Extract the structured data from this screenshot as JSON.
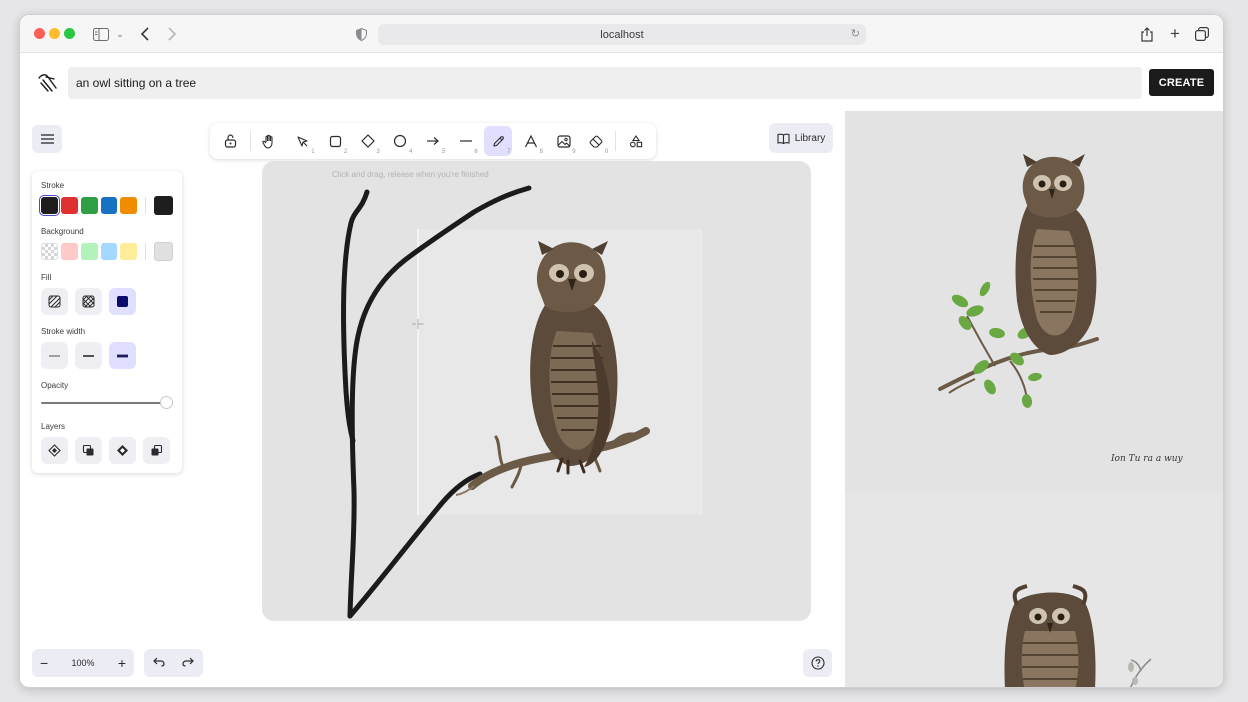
{
  "browser": {
    "url": "localhost"
  },
  "prompt": {
    "value": "an owl sitting on a tree",
    "create_label": "CREATE"
  },
  "toolbar": {
    "tools": [
      {
        "name": "lock-tool",
        "icon": "lock-icon",
        "key": ""
      },
      {
        "name": "hand-tool",
        "icon": "hand-icon",
        "key": ""
      },
      {
        "name": "selection-tool",
        "icon": "cursor-icon",
        "key": "1"
      },
      {
        "name": "rectangle-tool",
        "icon": "rectangle-icon",
        "key": "2"
      },
      {
        "name": "diamond-tool",
        "icon": "diamond-icon",
        "key": "3"
      },
      {
        "name": "ellipse-tool",
        "icon": "ellipse-icon",
        "key": "4"
      },
      {
        "name": "arrow-tool",
        "icon": "arrow-icon",
        "key": "5"
      },
      {
        "name": "line-tool",
        "icon": "line-icon",
        "key": "6"
      },
      {
        "name": "draw-tool",
        "icon": "pencil-icon",
        "key": "7",
        "active": true
      },
      {
        "name": "text-tool",
        "icon": "text-icon",
        "key": "8"
      },
      {
        "name": "image-tool",
        "icon": "image-icon",
        "key": "9"
      },
      {
        "name": "eraser-tool",
        "icon": "eraser-icon",
        "key": "0"
      },
      {
        "name": "shapes-tool",
        "icon": "shapes-icon",
        "key": ""
      }
    ],
    "library_label": "Library"
  },
  "properties": {
    "stroke_label": "Stroke",
    "stroke_colors": [
      "#1e1e1e",
      "#e03131",
      "#2f9e44",
      "#1971c2",
      "#f08c00"
    ],
    "stroke_current": "#1e1e1e",
    "background_label": "Background",
    "background_colors": [
      "transparent",
      "#ffc9c9",
      "#b2f2bb",
      "#a5d8ff",
      "#ffec99"
    ],
    "background_current": "#e0e0e0",
    "fill_label": "Fill",
    "stroke_width_label": "Stroke width",
    "opacity_label": "Opacity",
    "opacity_value": 100,
    "layers_label": "Layers"
  },
  "canvas": {
    "hint": "Click and drag, release when you're finished"
  },
  "footer": {
    "zoom": "100%"
  },
  "generated": {
    "caption": "Ion Tu ra a wuy"
  }
}
